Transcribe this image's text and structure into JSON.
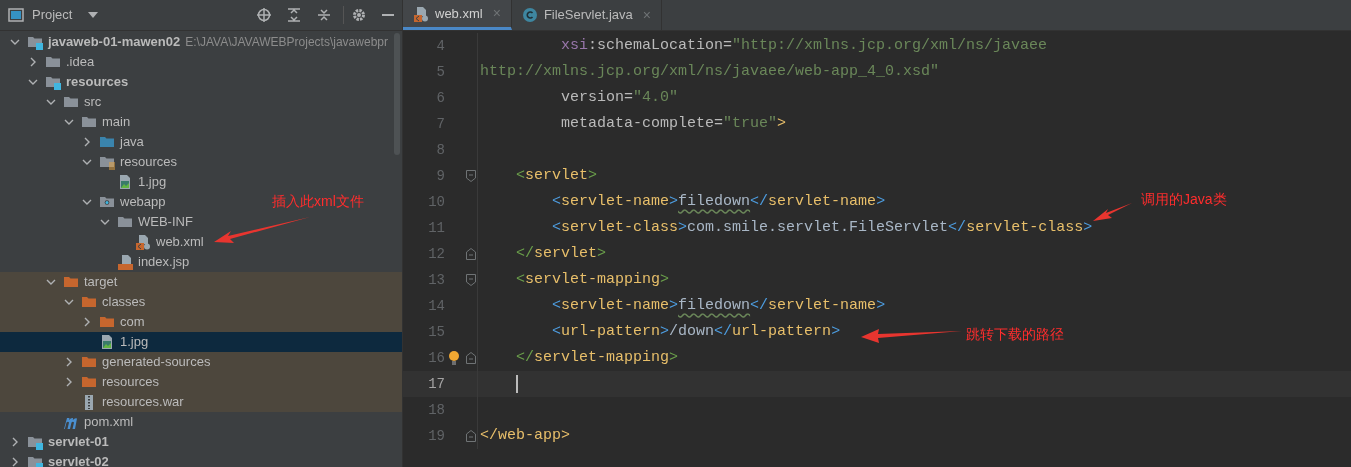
{
  "project_panel": {
    "title": "Project"
  },
  "tree": [
    {
      "label": "javaweb-01-mawen02",
      "path": "E:\\JAVA\\JAVAWEBProjects\\javawebpr",
      "kind": "module",
      "expanded": true,
      "selected": false,
      "children": [
        {
          "label": ".idea",
          "kind": "folder",
          "expanded": false,
          "selected": false
        },
        {
          "label": "resources",
          "kind": "module",
          "expanded": true,
          "selected": false,
          "children": [
            {
              "label": "src",
              "kind": "folder",
              "expanded": true,
              "selected": false,
              "children": [
                {
                  "label": "main",
                  "kind": "folder",
                  "expanded": true,
                  "selected": false,
                  "children": [
                    {
                      "label": "java",
                      "kind": "sources",
                      "expanded": false,
                      "selected": false
                    },
                    {
                      "label": "resources",
                      "kind": "resources",
                      "expanded": true,
                      "selected": false,
                      "children": [
                        {
                          "label": "1.jpg",
                          "kind": "image",
                          "selected": false
                        }
                      ]
                    },
                    {
                      "label": "webapp",
                      "kind": "web",
                      "expanded": true,
                      "selected": false,
                      "children": [
                        {
                          "label": "WEB-INF",
                          "kind": "folder",
                          "expanded": true,
                          "selected": false,
                          "children": [
                            {
                              "label": "web.xml",
                              "kind": "xml",
                              "selected": false
                            }
                          ]
                        },
                        {
                          "label": "index.jsp",
                          "kind": "jsp",
                          "selected": false
                        }
                      ]
                    }
                  ]
                }
              ]
            },
            {
              "label": "target",
              "kind": "excluded",
              "excluded": true,
              "expanded": true,
              "selected": false,
              "children": [
                {
                  "label": "classes",
                  "kind": "excluded",
                  "expanded": true,
                  "selected": false,
                  "children": [
                    {
                      "label": "com",
                      "kind": "excluded",
                      "expanded": false,
                      "selected": false
                    },
                    {
                      "label": "1.jpg",
                      "kind": "image",
                      "selected": true
                    }
                  ]
                },
                {
                  "label": "generated-sources",
                  "kind": "excluded",
                  "expanded": false,
                  "selected": false
                },
                {
                  "label": "resources",
                  "kind": "excluded",
                  "expanded": false,
                  "selected": false
                },
                {
                  "label": "resources.war",
                  "kind": "archive",
                  "selected": false
                }
              ]
            },
            {
              "label": "pom.xml",
              "kind": "maven",
              "selected": false
            }
          ]
        }
      ]
    },
    {
      "label": "servlet-01",
      "kind": "module",
      "expanded": false,
      "selected": false
    },
    {
      "label": "servlet-02",
      "kind": "module",
      "expanded": false,
      "selected": false
    }
  ],
  "tabs": [
    {
      "label": "web.xml",
      "kind": "xml",
      "selected": true,
      "close": "×"
    },
    {
      "label": "FileServlet.java",
      "kind": "class",
      "selected": false,
      "close": "×"
    }
  ],
  "editor": {
    "lines": [
      {
        "number": "4",
        "kind": "continuation",
        "segments": [
          {
            "kind": "ns",
            "text": "xsi"
          },
          {
            "kind": "attr",
            "text": ":schemaLocation="
          },
          {
            "kind": "string",
            "text": "\"http://xmlns.jcp.org/xml/ns/javaee"
          }
        ]
      },
      {
        "number": "5",
        "kind": "top",
        "segments": [
          {
            "kind": "string",
            "text": "http://xmlns.jcp.org/xml/ns/javaee/web-app_4_0.xsd\""
          }
        ]
      },
      {
        "number": "6",
        "kind": "continuation",
        "segments": [
          {
            "kind": "attr",
            "text": "version="
          },
          {
            "kind": "string",
            "text": "\"4.0\""
          }
        ]
      },
      {
        "number": "7",
        "kind": "continuation",
        "segments": [
          {
            "kind": "attr",
            "text": "metadata-complete="
          },
          {
            "kind": "string",
            "text": "\"true\""
          },
          {
            "kind": "tag",
            "text": ">"
          }
        ]
      },
      {
        "number": "8",
        "kind": "top"
      },
      {
        "number": "9",
        "kind": "element",
        "fold_open": true,
        "segments": [
          {
            "kind": "bracket-green",
            "text": "<"
          },
          {
            "kind": "tag",
            "text": "servlet"
          },
          {
            "kind": "bracket-green",
            "text": ">"
          }
        ]
      },
      {
        "number": "10",
        "kind": "child",
        "segments": [
          {
            "kind": "bracket-blue",
            "text": "<"
          },
          {
            "kind": "tag",
            "text": "servlet-name"
          },
          {
            "kind": "bracket-blue",
            "text": ">"
          },
          {
            "kind": "text",
            "text": "filedown",
            "spell_warning": true
          },
          {
            "kind": "bracket-blue",
            "text": "</"
          },
          {
            "kind": "tag",
            "text": "servlet-name"
          },
          {
            "kind": "bracket-blue",
            "text": ">"
          }
        ]
      },
      {
        "number": "11",
        "kind": "child",
        "segments": [
          {
            "kind": "bracket-blue",
            "text": "<"
          },
          {
            "kind": "tag",
            "text": "servlet-class"
          },
          {
            "kind": "bracket-blue",
            "text": ">"
          },
          {
            "kind": "text",
            "text": "com.smile.servlet.FileServlet"
          },
          {
            "kind": "bracket-blue",
            "text": "</"
          },
          {
            "kind": "tag",
            "text": "servlet-class"
          },
          {
            "kind": "bracket-blue",
            "text": ">"
          }
        ]
      },
      {
        "number": "12",
        "kind": "element",
        "fold_close": true,
        "segments": [
          {
            "kind": "bracket-green",
            "text": "</"
          },
          {
            "kind": "tag",
            "text": "servlet"
          },
          {
            "kind": "bracket-green",
            "text": ">"
          }
        ]
      },
      {
        "number": "13",
        "kind": "element",
        "fold_open": true,
        "segments": [
          {
            "kind": "bracket-green",
            "text": "<"
          },
          {
            "kind": "tag",
            "text": "servlet-mapping"
          },
          {
            "kind": "bracket-green",
            "text": ">"
          }
        ]
      },
      {
        "number": "14",
        "kind": "child",
        "segments": [
          {
            "kind": "bracket-blue",
            "text": "<"
          },
          {
            "kind": "tag",
            "text": "servlet-name"
          },
          {
            "kind": "bracket-blue",
            "text": ">"
          },
          {
            "kind": "text",
            "text": "filedown",
            "spell_warning": true
          },
          {
            "kind": "bracket-blue",
            "text": "</"
          },
          {
            "kind": "tag",
            "text": "servlet-name"
          },
          {
            "kind": "bracket-blue",
            "text": ">"
          }
        ]
      },
      {
        "number": "15",
        "kind": "child",
        "segments": [
          {
            "kind": "bracket-blue",
            "text": "<"
          },
          {
            "kind": "tag",
            "text": "url-pattern"
          },
          {
            "kind": "bracket-blue",
            "text": ">"
          },
          {
            "kind": "text",
            "text": "/down"
          },
          {
            "kind": "bracket-blue",
            "text": "</"
          },
          {
            "kind": "tag",
            "text": "url-pattern"
          },
          {
            "kind": "bracket-blue",
            "text": ">"
          }
        ]
      },
      {
        "number": "16",
        "kind": "element",
        "fold_close": true,
        "bulb": true,
        "segments": [
          {
            "kind": "bracket-green",
            "text": "</"
          },
          {
            "kind": "tag",
            "text": "servlet-mapping"
          },
          {
            "kind": "bracket-green",
            "text": ">"
          }
        ]
      },
      {
        "number": "17",
        "kind": "element",
        "current": true
      },
      {
        "number": "18",
        "kind": "top"
      },
      {
        "number": "19",
        "kind": "top",
        "fold_close": true,
        "segments": [
          {
            "kind": "tag",
            "text": "</web-app>"
          }
        ]
      }
    ]
  },
  "annotations": [
    {
      "text": "插入此xml文件"
    },
    {
      "text": "调用的Java类"
    },
    {
      "text": "跳转下载的路径"
    }
  ]
}
